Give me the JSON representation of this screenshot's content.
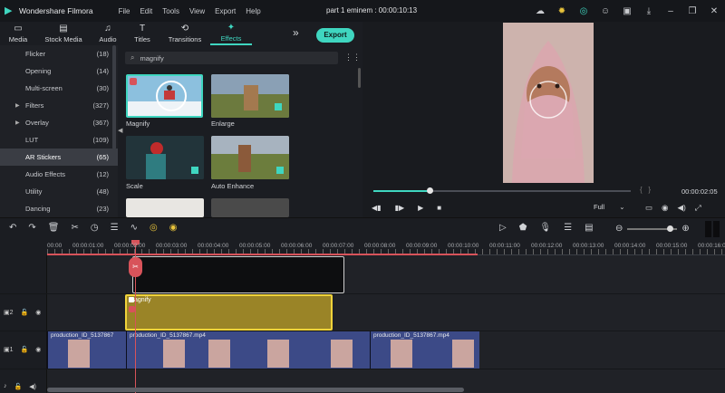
{
  "titlebar": {
    "app_name": "Wondershare Filmora",
    "menu": [
      "File",
      "Edit",
      "Tools",
      "View",
      "Export",
      "Help"
    ],
    "project": "part 1 eminem : 00:00:10:13"
  },
  "tabs": [
    {
      "label": "Media",
      "icon": "folder-icon"
    },
    {
      "label": "Stock Media",
      "icon": "stock-icon"
    },
    {
      "label": "Audio",
      "icon": "music-icon"
    },
    {
      "label": "Titles",
      "icon": "titles-icon"
    },
    {
      "label": "Transitions",
      "icon": "transitions-icon"
    },
    {
      "label": "Effects",
      "icon": "effects-icon"
    }
  ],
  "export_label": "Export",
  "categories": [
    {
      "label": "Flicker",
      "count": "(18)"
    },
    {
      "label": "Opening",
      "count": "(14)"
    },
    {
      "label": "Multi-screen",
      "count": "(30)"
    },
    {
      "label": "Filters",
      "count": "(327)",
      "expandable": true
    },
    {
      "label": "Overlay",
      "count": "(367)",
      "expandable": true
    },
    {
      "label": "LUT",
      "count": "(109)"
    },
    {
      "label": "AR Stickers",
      "count": "(65)"
    },
    {
      "label": "Audio Effects",
      "count": "(12)"
    },
    {
      "label": "Utility",
      "count": "(48)"
    },
    {
      "label": "Dancing",
      "count": "(23)"
    }
  ],
  "search": {
    "value": "magnify"
  },
  "effects": [
    {
      "label": "Magnify",
      "selected": true
    },
    {
      "label": "Enlarge"
    },
    {
      "label": "Scale"
    },
    {
      "label": "Auto Enhance"
    }
  ],
  "preview": {
    "time": "00:00:02:05",
    "quality": "Full",
    "progress": 0.22
  },
  "ruler_ticks": [
    "00:00",
    "00:00:01:00",
    "00:00:02:00",
    "00:00:03:00",
    "00:00:04:00",
    "00:00:05:00",
    "00:00:06:00",
    "00:00:07:00",
    "00:00:08:00",
    "00:00:09:00",
    "00:00:10:00",
    "00:00:11:00",
    "00:00:12:00",
    "00:00:13:00",
    "00:00:14:00",
    "00:00:15:00",
    "00:00:16:00"
  ],
  "tracks": {
    "fx_track_label": "2",
    "video_track_label": "1",
    "fx_clip_label": "agnify",
    "video_clip_names": [
      "production_ID_5137867",
      "production_ID_5137867.mp4",
      "production_ID_5137867.mp4"
    ]
  },
  "zoom_level": 0.8
}
